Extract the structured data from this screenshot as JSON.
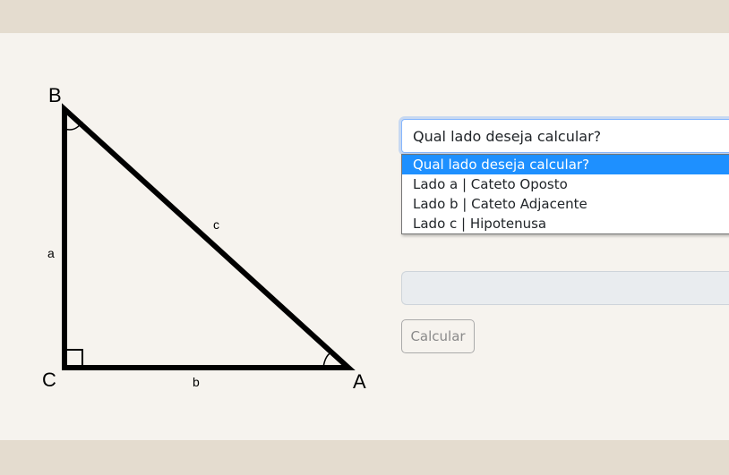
{
  "diagram": {
    "vertices": {
      "A": "A",
      "B": "B",
      "C": "C"
    },
    "sides": {
      "a": "a",
      "b": "b",
      "c": "c"
    }
  },
  "form": {
    "select_value": "Qual lado deseja calcular?",
    "options": [
      "Qual lado deseja calcular?",
      "Lado a | Cateto Oposto",
      "Lado b | Cateto Adjacente",
      "Lado c | Hipotenusa"
    ],
    "selected_option_index": 0,
    "result_value": "",
    "calculate_button": "Calcular"
  }
}
